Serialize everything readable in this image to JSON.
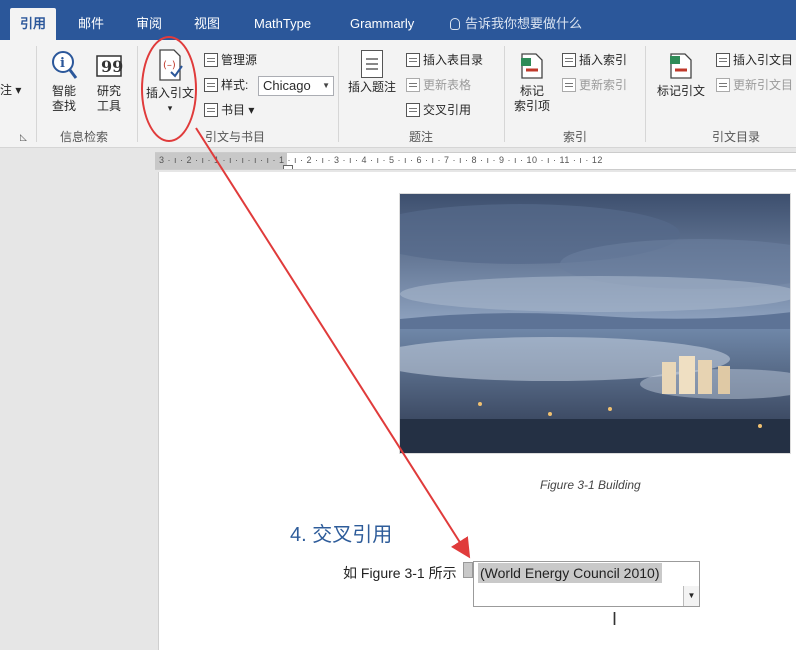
{
  "tabs": [
    "引用",
    "邮件",
    "审阅",
    "视图",
    "MathType",
    "Grammarly"
  ],
  "tell_me": "告诉我你想要做什么",
  "ribbon": {
    "left_partial_label": "注",
    "info_search": {
      "smart_lookup": "智能\n查找",
      "smart_lookup_l1": "智能",
      "smart_lookup_l2": "查找",
      "researcher_l1": "研究",
      "researcher_l2": "工具",
      "group_label": "信息检索"
    },
    "citations": {
      "insert_citation": "插入引文",
      "manage_sources": "管理源",
      "style_label": "样式:",
      "style_value": "Chicago",
      "bibliography": "书目",
      "group_label": "引文与书目"
    },
    "captions": {
      "insert_caption": "插入题注",
      "insert_table_of_figures": "插入表目录",
      "update_table": "更新表格",
      "cross_reference": "交叉引用",
      "group_label": "题注"
    },
    "index": {
      "mark_entry_l1": "标记",
      "mark_entry_l2": "索引项",
      "insert_index": "插入索引",
      "update_index": "更新索引",
      "group_label": "索引"
    },
    "toa": {
      "mark_citation": "标记引文",
      "insert_toa": "插入引文目",
      "update_toa": "更新引文目",
      "group_label": "引文目录"
    }
  },
  "ruler_text": "3 · ı · 2 · ı · 1 · ı · ı · ı · ı · 1 · ı · 2 · ı · 3 · ı · 4 · ı · 5 · ı · 6 · ı · 7 · ı · 8 · ı · 9 · ı · 10 · ı · 11 · ı · 12",
  "document": {
    "figure_caption": "Figure 3-1 Building",
    "heading": "4. 交叉引用",
    "body_text": "如 Figure 3-1 所示",
    "citation_field": "(World Energy Council 2010)"
  },
  "colors": {
    "tabbar": "#2b579a",
    "ribbon": "#f3f3f3",
    "annotation_red": "#e03b3b",
    "heading_blue": "#2e5c9a"
  }
}
